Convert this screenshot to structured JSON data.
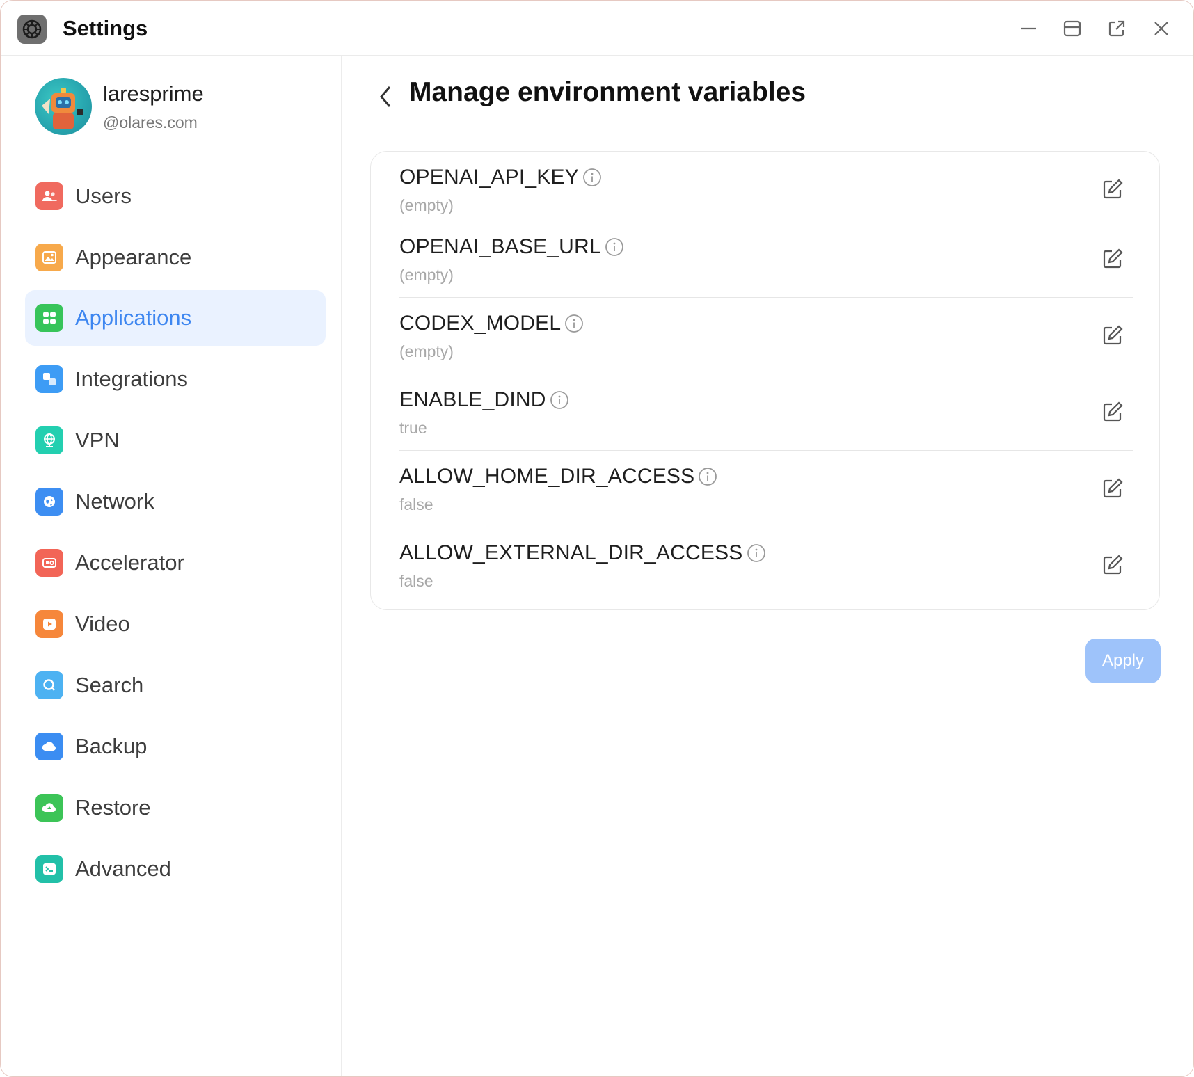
{
  "app": {
    "title": "Settings"
  },
  "user": {
    "name": "laresprime",
    "domain": "@olares.com"
  },
  "sidebar": {
    "items": [
      {
        "label": "Users",
        "icon": "users-icon",
        "color": "#f06a5f",
        "active": false
      },
      {
        "label": "Appearance",
        "icon": "appearance-icon",
        "color": "#f7a94b",
        "active": false
      },
      {
        "label": "Applications",
        "icon": "applications-icon",
        "color": "#37c45a",
        "active": true
      },
      {
        "label": "Integrations",
        "icon": "integrations-icon",
        "color": "#3d9cf5",
        "active": false
      },
      {
        "label": "VPN",
        "icon": "vpn-icon",
        "color": "#23cfb0",
        "active": false
      },
      {
        "label": "Network",
        "icon": "network-icon",
        "color": "#3d8ef2",
        "active": false
      },
      {
        "label": "Accelerator",
        "icon": "accelerator-icon",
        "color": "#f26557",
        "active": false
      },
      {
        "label": "Video",
        "icon": "video-icon",
        "color": "#f6873b",
        "active": false
      },
      {
        "label": "Search",
        "icon": "search-icon",
        "color": "#4db2f2",
        "active": false
      },
      {
        "label": "Backup",
        "icon": "backup-icon",
        "color": "#3b8df2",
        "active": false
      },
      {
        "label": "Restore",
        "icon": "restore-icon",
        "color": "#3cc457",
        "active": false
      },
      {
        "label": "Advanced",
        "icon": "advanced-icon",
        "color": "#22c0a8",
        "active": false
      }
    ]
  },
  "main": {
    "title": "Manage environment variables",
    "variables": [
      {
        "name": "OPENAI_API_KEY",
        "value": "(empty)"
      },
      {
        "name": "OPENAI_BASE_URL",
        "value": "(empty)"
      },
      {
        "name": "CODEX_MODEL",
        "value": "(empty)"
      },
      {
        "name": "ENABLE_DIND",
        "value": "true"
      },
      {
        "name": "ALLOW_HOME_DIR_ACCESS",
        "value": "false"
      },
      {
        "name": "ALLOW_EXTERNAL_DIR_ACCESS",
        "value": "false"
      }
    ],
    "apply_label": "Apply"
  },
  "colors": {
    "accent": "#3d86f0",
    "active_bg": "#eaf2ff",
    "apply_disabled": "#9ec3fa"
  }
}
